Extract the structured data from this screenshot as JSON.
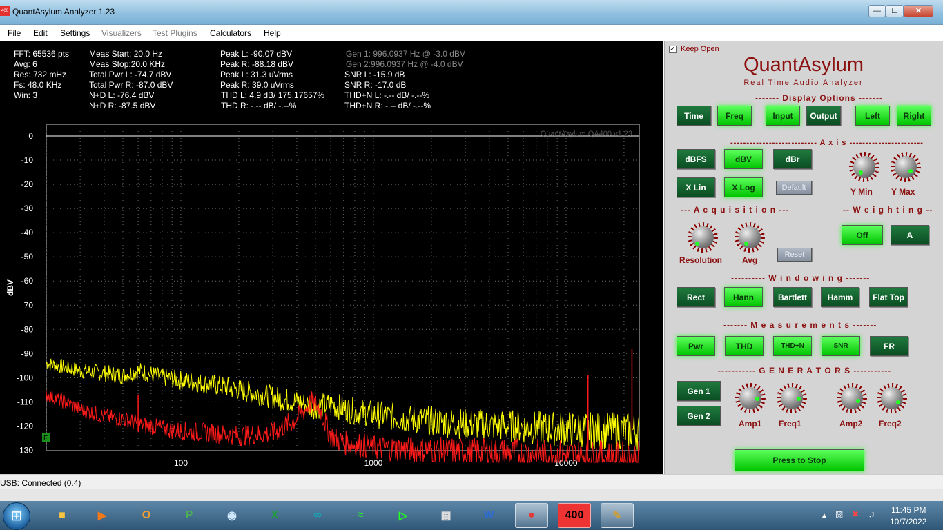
{
  "window": {
    "title": "QuantAsylum Analyzer 1.23",
    "icon_text": "400",
    "min": "—",
    "max": "☐",
    "close": "✕"
  },
  "menu": [
    "File",
    "Edit",
    "Settings",
    "Visualizers",
    "Test Plugins",
    "Calculators",
    "Help"
  ],
  "readouts": {
    "col1": [
      "FFT: 65536 pts",
      "Avg: 6",
      "Res: 732 mHz",
      "Fs: 48.0 KHz",
      "Win: 3"
    ],
    "col2": [
      "Meas Start: 20.0 Hz",
      "Meas Stop:20.0 KHz",
      "Total Pwr L: -74.7 dBV",
      "Total Pwr R: -87.0 dBV",
      "N+D L: -76.4 dBV",
      "N+D R: -87.5 dBV"
    ],
    "col3": [
      "Peak L: -90.07 dBV",
      "Peak R: -88.18 dBV",
      "Peak L: 31.3 uVrms",
      "Peak R: 39.0 uVrms",
      "THD L: 4.9 dB/ 175.17657%",
      "THD R: -.-- dB/ -.--%"
    ],
    "col4": [
      "Gen 1: 996.0937 Hz @ -3.0  dBV",
      "Gen 2:996.0937 Hz @ -4.0  dBV",
      "SNR L: -15.9 dB",
      "SNR R: -17.0 dB",
      "THD+N L: -.-- dB/ -.--%",
      "THD+N R: -.-- dB/ -.--%"
    ]
  },
  "chart_data": {
    "type": "line",
    "watermark": "QuantAsylum QA400 v1.23",
    "ylabel": "dBV",
    "xlabel": "",
    "xscale": "log",
    "xlim": [
      20,
      24000
    ],
    "ylim": [
      -135,
      0
    ],
    "xticks": [
      100,
      1000,
      10000
    ],
    "yticks": [
      0,
      -10,
      -20,
      -30,
      -40,
      -50,
      -60,
      -70,
      -80,
      -90,
      -100,
      -110,
      -120,
      -130
    ],
    "marker_label": "F",
    "grid": true,
    "series": [
      {
        "color": "#ffff00",
        "points": [
          [
            20,
            -94
          ],
          [
            30,
            -97
          ],
          [
            50,
            -99
          ],
          [
            60,
            -97
          ],
          [
            80,
            -100
          ],
          [
            100,
            -101
          ],
          [
            150,
            -103
          ],
          [
            200,
            -105
          ],
          [
            300,
            -108
          ],
          [
            400,
            -110
          ],
          [
            500,
            -112
          ],
          [
            600,
            -111
          ],
          [
            800,
            -114
          ],
          [
            1000,
            -115
          ],
          [
            1500,
            -117
          ],
          [
            2000,
            -118
          ],
          [
            3000,
            -119
          ],
          [
            5000,
            -120
          ],
          [
            8000,
            -121
          ],
          [
            10000,
            -121
          ],
          [
            15000,
            -122
          ],
          [
            20000,
            -122
          ],
          [
            24000,
            -122
          ]
        ]
      },
      {
        "color": "#ff1a1a",
        "points": [
          [
            20,
            -107
          ],
          [
            25,
            -110
          ],
          [
            30,
            -113
          ],
          [
            40,
            -116
          ],
          [
            50,
            -117
          ],
          [
            60,
            -119
          ],
          [
            80,
            -121
          ],
          [
            100,
            -122
          ],
          [
            150,
            -123
          ],
          [
            200,
            -124
          ],
          [
            300,
            -123
          ],
          [
            400,
            -117
          ],
          [
            480,
            -110
          ],
          [
            520,
            -112
          ],
          [
            600,
            -124
          ],
          [
            700,
            -127
          ],
          [
            900,
            -128
          ],
          [
            1000,
            -129
          ],
          [
            2000,
            -130
          ],
          [
            5000,
            -131
          ],
          [
            10000,
            -132
          ],
          [
            20000,
            -133
          ],
          [
            24000,
            -133
          ]
        ]
      }
    ],
    "spikes": [
      {
        "x": 60,
        "ylow": -122,
        "yhigh": -107,
        "color": "#ff1a1a"
      },
      {
        "x": 13000,
        "ylow": -130,
        "yhigh": -99,
        "color": "#ff1a1a"
      },
      {
        "x": 22000,
        "ylow": -122,
        "yhigh": -88,
        "color": "#ff1a1a"
      }
    ]
  },
  "panel": {
    "keep_open": "Keep Open",
    "keep_check": "✓",
    "brand": "QuantAsylum",
    "tagline": "Real Time Audio Analyzer",
    "display_title": "------- Display Options -------",
    "display": [
      "Time",
      "Freq",
      "Input",
      "Output",
      "Left",
      "Right"
    ],
    "axis_title": "--------------------------- A x i s -----------------------",
    "axis": [
      "dBFS",
      "dBV",
      "dBr",
      "X Lin",
      "X Log"
    ],
    "default": "Default",
    "ymin": "Y Min",
    "ymax": "Y Max",
    "acq_title": "--- A c q u i s i t i o n ---",
    "weight_title": "-- W e i g h t i n g --",
    "resolution": "Resolution",
    "avg": "Avg",
    "reset": "Reset",
    "weighting": [
      "Off",
      "A"
    ],
    "win_title": "---------- W i n d o w i n g -------",
    "windowing": [
      "Rect",
      "Hann",
      "Bartlett",
      "Hamm",
      "Flat Top"
    ],
    "meas_title": "------- M e a s u r e m e n t s -------",
    "measurements": [
      "Pwr",
      "THD",
      "THD+N",
      "SNR",
      "FR"
    ],
    "gen_title": "----------- G E N E R A T O R S -----------",
    "gens": [
      "Gen 1",
      "Gen 2"
    ],
    "amp1": "Amp1",
    "freq1": "Freq1",
    "amp2": "Amp2",
    "freq2": "Freq2",
    "stop": "Press to Stop"
  },
  "status": "USB: Connected  (0.4)",
  "taskbar": {
    "start": "⊞",
    "app400": "400",
    "time": "11:45 PM",
    "date": "10/7/2022"
  }
}
